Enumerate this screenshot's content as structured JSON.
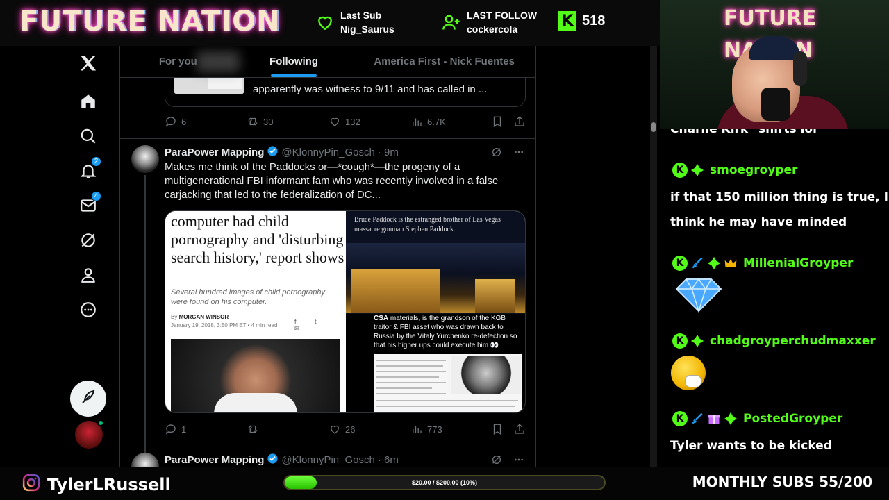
{
  "overlay": {
    "logo": "FUTURE NATION",
    "last_sub": {
      "label": "Last Sub",
      "value": "Nig_Saurus"
    },
    "last_follow": {
      "label": "LAST FOLLOW",
      "value": "cockercola"
    },
    "kick_followers": "518",
    "kick_letter": "K",
    "cam_title": "FUTURE NATION",
    "instagram_handle": "TylerLRussell",
    "goal": {
      "text": "$20.00 / $200.00 (10%)",
      "progress": 0.1
    },
    "monthly_subs": "MONTHLY SUBS 55/200",
    "colors": {
      "kick_green": "#53fc18",
      "x_blue": "#1d9bf0"
    }
  },
  "x_nav": {
    "items": [
      {
        "icon": "x-logo-icon"
      },
      {
        "icon": "home-icon"
      },
      {
        "icon": "search-icon"
      },
      {
        "icon": "bell-icon",
        "badge": "2"
      },
      {
        "icon": "mail-icon",
        "badge": "4"
      },
      {
        "icon": "grok-icon"
      },
      {
        "icon": "profile-icon"
      },
      {
        "icon": "more-icon"
      }
    ],
    "compose_icon": "feather-icon"
  },
  "timeline": {
    "tabs": [
      "For you",
      "Following",
      "America First - Nick Fuentes"
    ],
    "active_tab": "Following",
    "prev_tweet": {
      "text": "apparently was witness to 9/11 and has called in ...",
      "replies": "6",
      "reposts": "30",
      "likes": "132",
      "views": "6.7K"
    },
    "tweet1": {
      "name": "ParaPower Mapping",
      "handle": "@KlonnyPin_Gosch",
      "time": "· 9m",
      "text": "Makes me think of the Paddocks or—*cough*—the progeny of a multigenerational FBI informant fam who was recently involved in a false carjacking that led to the federalization of DC...",
      "media": {
        "headline": "computer had child pornography and 'disturbing search history,' report shows",
        "subhead": "Several hundred images of child pornography were found on his computer.",
        "byline_by": "By",
        "byline_name": "MORGAN WINSOR",
        "date": "January 19, 2018, 3:50 PM ET • 4 min read",
        "share_icons": "f t ✉",
        "caption": "Bruce Paddock is the estranged brother of Las Vegas massacre gunman Stephen Paddock.",
        "csa_bold": "CSA",
        "csa_text": " materials, is the grandson of the KGB traitor & FBI asset who was drawn back to Russia by the Vitaly Yurchenko re-defection so that his higher ups could execute him 👀"
      },
      "replies": "1",
      "reposts": "",
      "likes": "26",
      "views": "773"
    },
    "tweet2": {
      "name": "ParaPower Mapping",
      "handle": "@KlonnyPin_Gosch",
      "time": "· 6m"
    }
  },
  "chat": {
    "partial_line": "Charlie Kirk\" shirts lol",
    "messages": [
      {
        "user": "smoegroyper",
        "text_lines": [
          "if that 150 million thing is true, I",
          "think he may have minded"
        ]
      },
      {
        "user": "MillenialGroyper",
        "emote": "diamond-emote"
      },
      {
        "user": "chadgroyperchudmaxxer",
        "emote": "smiley-emote"
      },
      {
        "user": "PostedGroyper",
        "text_lines": [
          "Tyler wants to be kicked"
        ]
      }
    ]
  }
}
